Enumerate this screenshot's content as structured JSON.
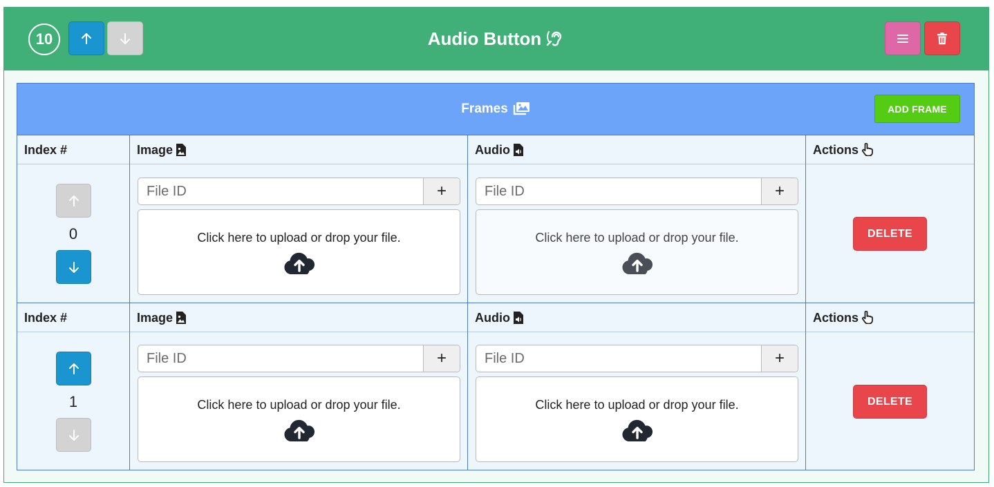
{
  "header": {
    "index_number": "10",
    "title": "Audio Button",
    "up_icon": "arrow-up-icon",
    "down_icon": "arrow-down-icon",
    "menu_icon": "menu-icon",
    "trash_icon": "trash-icon",
    "title_icon": "ear-listen-icon"
  },
  "frames": {
    "title": "Frames",
    "title_icon": "images-icon",
    "add_label": "ADD FRAME",
    "columns": {
      "index": "Index #",
      "image": "Image",
      "audio": "Audio",
      "actions": "Actions"
    },
    "rows": [
      {
        "index": "0",
        "image": {
          "placeholder": "File ID",
          "value": "",
          "plus": "+",
          "dropzone_text": "Click here to upload or drop your file."
        },
        "audio": {
          "placeholder": "File ID",
          "value": "",
          "plus": "+",
          "dropzone_text": "Click here to upload or drop your file."
        },
        "delete_label": "DELETE"
      },
      {
        "index": "1",
        "image": {
          "placeholder": "File ID",
          "value": "",
          "plus": "+",
          "dropzone_text": "Click here to upload or drop your file."
        },
        "audio": {
          "placeholder": "File ID",
          "value": "",
          "plus": "+",
          "dropzone_text": "Click here to upload or drop your file."
        },
        "delete_label": "DELETE"
      }
    ]
  },
  "colors": {
    "header_bg": "#40b078",
    "frames_head_bg": "#6ba4f8",
    "add_frame_bg": "#55cc14",
    "primary_blue": "#1a95cf",
    "disabled_gray": "#d3d3d3",
    "danger_red": "#e8464b",
    "menu_pink": "#de67a8"
  }
}
